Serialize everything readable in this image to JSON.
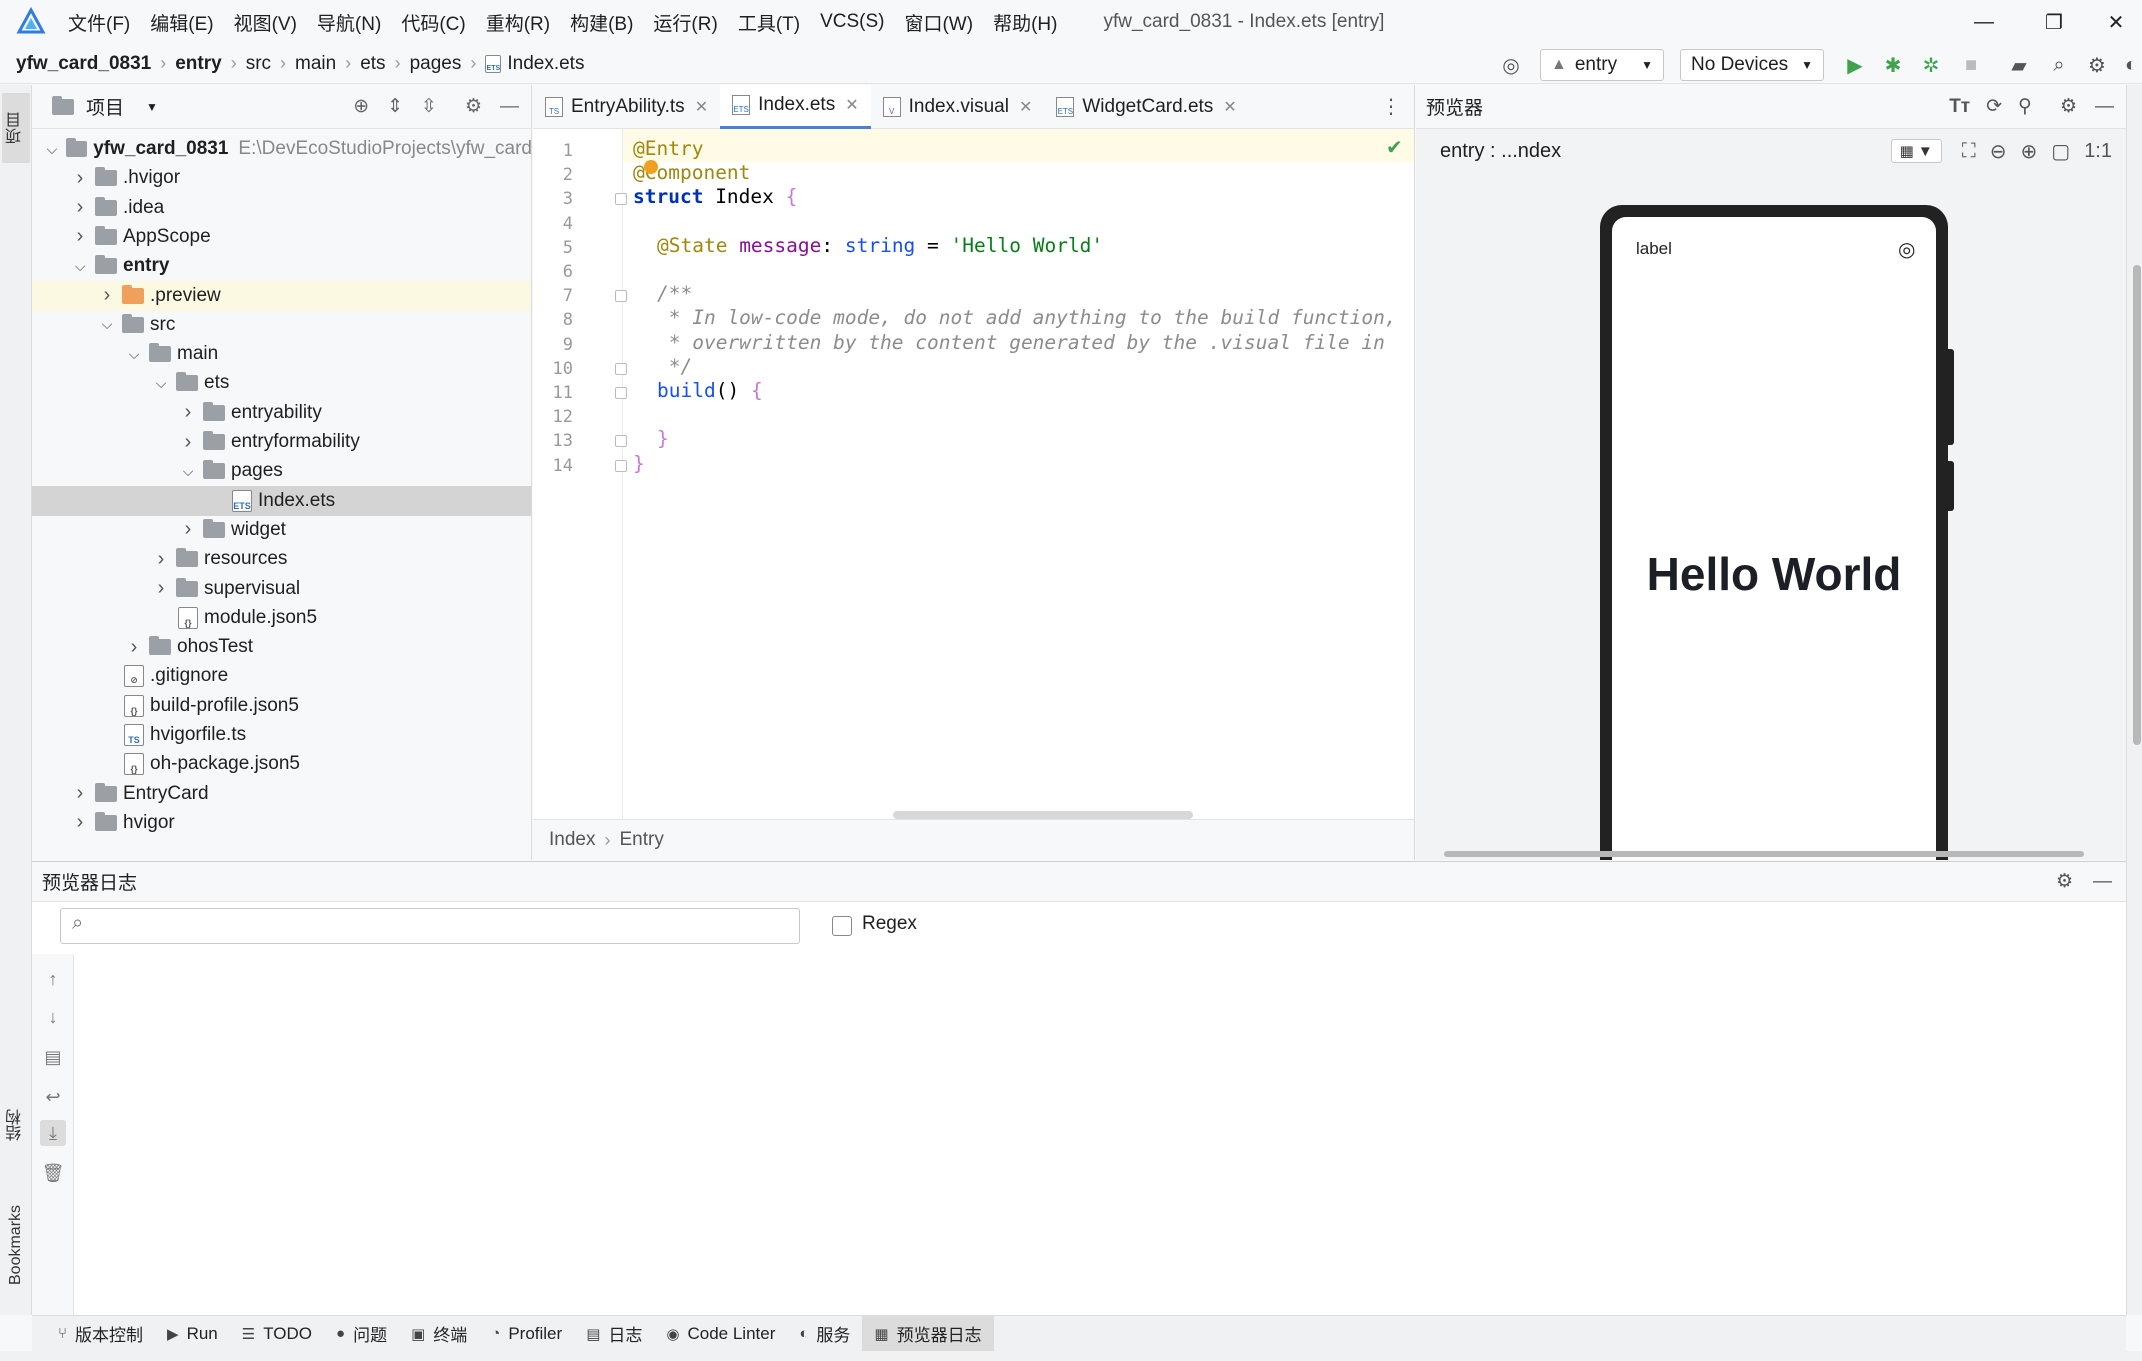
{
  "menu": [
    "文件(F)",
    "编辑(E)",
    "视图(V)",
    "导航(N)",
    "代码(C)",
    "重构(R)",
    "构建(B)",
    "运行(R)",
    "工具(T)",
    "VCS(S)",
    "窗口(W)",
    "帮助(H)"
  ],
  "window_title": "yfw_card_0831 - Index.ets [entry]",
  "window_controls": {
    "minimize": "—",
    "restore": "❐",
    "close": "✕"
  },
  "breadcrumb": [
    "yfw_card_0831",
    "entry",
    "src",
    "main",
    "ets",
    "pages",
    "Index.ets"
  ],
  "toolbar": {
    "run_config": "entry",
    "device": "No Devices"
  },
  "left_strip": {
    "project_tab": "项目",
    "structure_tab": "结构",
    "bookmarks_tab": "Bookmarks"
  },
  "project_panel": {
    "title": "项目",
    "tree": [
      {
        "label": "yfw_card_0831",
        "path": "E:\\DevEcoStudioProjects\\yfw_card",
        "depth": 0,
        "expanded": true,
        "type": "project"
      },
      {
        "label": ".hvigor",
        "depth": 1,
        "expanded": false,
        "type": "folder"
      },
      {
        "label": ".idea",
        "depth": 1,
        "expanded": false,
        "type": "folder"
      },
      {
        "label": "AppScope",
        "depth": 1,
        "expanded": false,
        "type": "folder"
      },
      {
        "label": "entry",
        "depth": 1,
        "expanded": true,
        "type": "module"
      },
      {
        "label": ".preview",
        "depth": 2,
        "expanded": false,
        "type": "folder-orange"
      },
      {
        "label": "src",
        "depth": 2,
        "expanded": true,
        "type": "folder"
      },
      {
        "label": "main",
        "depth": 3,
        "expanded": true,
        "type": "folder"
      },
      {
        "label": "ets",
        "depth": 4,
        "expanded": true,
        "type": "folder"
      },
      {
        "label": "entryability",
        "depth": 5,
        "expanded": false,
        "type": "folder"
      },
      {
        "label": "entryformability",
        "depth": 5,
        "expanded": false,
        "type": "folder"
      },
      {
        "label": "pages",
        "depth": 5,
        "expanded": true,
        "type": "folder"
      },
      {
        "label": "Index.ets",
        "depth": 6,
        "type": "ets-file"
      },
      {
        "label": "widget",
        "depth": 5,
        "expanded": false,
        "type": "folder"
      },
      {
        "label": "resources",
        "depth": 4,
        "expanded": false,
        "type": "folder"
      },
      {
        "label": "supervisual",
        "depth": 4,
        "expanded": false,
        "type": "folder"
      },
      {
        "label": "module.json5",
        "depth": 4,
        "type": "json-file"
      },
      {
        "label": "ohosTest",
        "depth": 3,
        "expanded": false,
        "type": "folder"
      },
      {
        "label": ".gitignore",
        "depth": 2,
        "type": "file"
      },
      {
        "label": "build-profile.json5",
        "depth": 2,
        "type": "json-file"
      },
      {
        "label": "hvigorfile.ts",
        "depth": 2,
        "type": "ts-file"
      },
      {
        "label": "oh-package.json5",
        "depth": 2,
        "type": "json-file"
      },
      {
        "label": "EntryCard",
        "depth": 1,
        "expanded": false,
        "type": "folder"
      },
      {
        "label": "hvigor",
        "depth": 1,
        "expanded": false,
        "type": "folder"
      }
    ]
  },
  "editor": {
    "tabs": [
      {
        "label": "EntryAbility.ts",
        "icon": "TS",
        "active": false
      },
      {
        "label": "Index.ets",
        "icon": "ETS",
        "active": true
      },
      {
        "label": "Index.visual",
        "icon": "V",
        "active": false
      },
      {
        "label": "WidgetCard.ets",
        "icon": "ETS",
        "active": false
      }
    ],
    "line_numbers": [
      "1",
      "2",
      "3",
      "4",
      "5",
      "6",
      "7",
      "8",
      "9",
      "10",
      "11",
      "12",
      "13",
      "14"
    ],
    "code": {
      "l1": "@Entry",
      "l2_a": "@",
      "l2_b": "Component",
      "l3_kw": "struct",
      "l3_name": " Index ",
      "l3_brace": "{",
      "l5_ann": "@State",
      "l5_prop": " message",
      "l5_colon": ": ",
      "l5_type": "string",
      "l5_eq": " = ",
      "l5_str": "'Hello World'",
      "l7": "/**",
      "l8": " * In low-code mode, do not add anything to the build function,",
      "l9": " * overwritten by the content generated by the .visual file in",
      "l10": " */",
      "l11_fn": "build",
      "l11_paren": "() ",
      "l11_brace": "{",
      "l13": "}",
      "l14": "}"
    },
    "breadcrumb": [
      "Index",
      "Entry"
    ]
  },
  "previewer": {
    "title": "预览器",
    "target": "entry : ...ndex",
    "phone_label": "label",
    "hello_text": "Hello World"
  },
  "log_panel": {
    "title": "预览器日志",
    "search_placeholder": "",
    "regex_label": "Regex"
  },
  "bottom_tabs": [
    {
      "label": "版本控制",
      "icon": "⑂"
    },
    {
      "label": "Run",
      "icon": "▶"
    },
    {
      "label": "TODO",
      "icon": "☰"
    },
    {
      "label": "问题",
      "icon": "●"
    },
    {
      "label": "终端",
      "icon": "▣"
    },
    {
      "label": "Profiler",
      "icon": "◔"
    },
    {
      "label": "日志",
      "icon": "▤"
    },
    {
      "label": "Code Linter",
      "icon": "◉"
    },
    {
      "label": "服务",
      "icon": "◐"
    },
    {
      "label": "预览器日志",
      "icon": "▦",
      "active": true
    }
  ]
}
